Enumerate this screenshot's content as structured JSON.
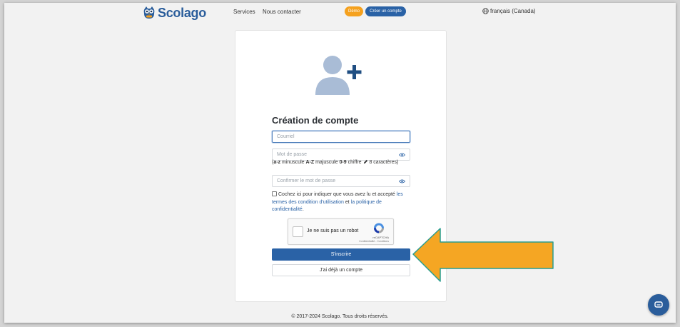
{
  "nav": {
    "logo_text": "Scolago",
    "links": [
      "Services",
      "Nous contacter"
    ],
    "demo_label": "Démo",
    "create_label": "Créer un compte",
    "language_label": "français (Canada)"
  },
  "form": {
    "title": "Création de compte",
    "email_placeholder": "Courriel",
    "password_placeholder": "Mot de passe",
    "password_hint": {
      "open": "(",
      "lower": "a-z",
      "lower_label": " minuscule ",
      "upper": "A-Z",
      "upper_label": " majuscule ",
      "digit": "0-9",
      "digit_label": " chiffre ",
      "length_label": " 8 caractères)"
    },
    "confirm_placeholder": "Confirmer le mot de passe",
    "terms": {
      "text1": "Cochez ici pour indiquer que vous avez lu et accepté ",
      "link1": "les termes des condition d'utilisation",
      "text2": " et ",
      "link2": "la politique de confidentialité",
      "text3": "."
    },
    "captcha": {
      "label": "Je ne suis pas un robot",
      "brand": "reCAPTCHA",
      "terms": "Confidentialité - Conditions"
    },
    "submit_label": "S'inscrire",
    "login_label": "J'ai déjà un compte"
  },
  "footer": {
    "copyright": "© 2017-2024 Scolago. Tous droits réservés."
  },
  "colors": {
    "primary": "#2a62a6",
    "demo": "#f5a11e",
    "arrow": "#f5a623",
    "arrow_border": "#2a9d8f"
  },
  "icons": [
    "owl-logo-icon",
    "globe-icon",
    "user-plus-icon",
    "eye-icon",
    "recaptcha-icon",
    "chat-icon"
  ]
}
